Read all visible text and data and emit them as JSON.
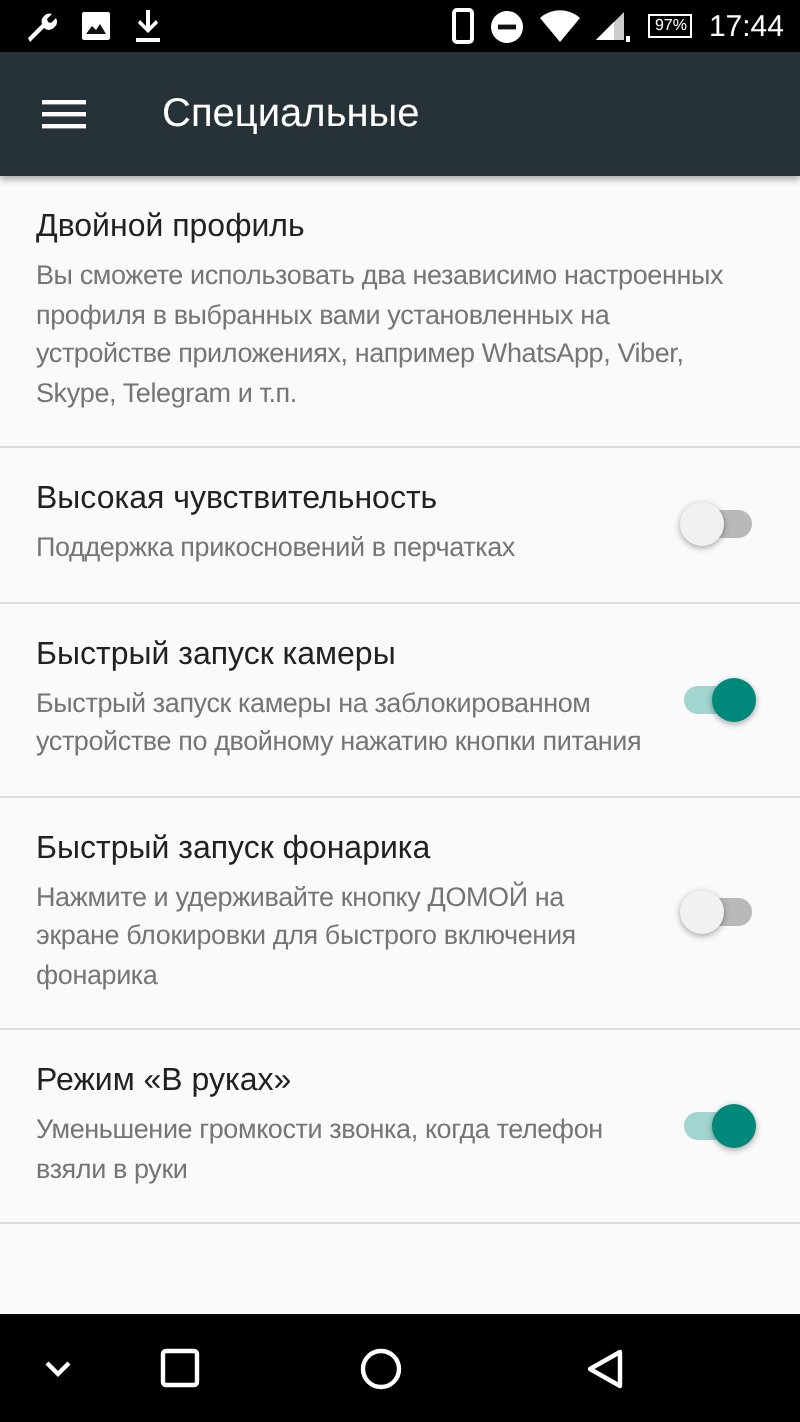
{
  "status_bar": {
    "battery": "97%",
    "time": "17:44"
  },
  "app_bar": {
    "title": "Специальные"
  },
  "settings": [
    {
      "kind": "plain",
      "title": "Двойной профиль",
      "summary": "Вы сможете использовать два независимо настроенных профиля в выбранных вами установленных на устройстве приложениях, например WhatsApp, Viber, Skype, Telegram и т.п."
    },
    {
      "kind": "switch",
      "title": "Высокая чувствительность",
      "summary": "Поддержка прикосновений в перчатках",
      "on": false
    },
    {
      "kind": "switch",
      "title": "Быстрый запуск камеры",
      "summary": "Быстрый запуск камеры на заблокированном устройстве по двойному нажатию кнопки питания",
      "on": true
    },
    {
      "kind": "switch",
      "title": "Быстрый запуск фонарика",
      "summary": "Нажмите и удерживайте кнопку ДОМОЙ на экране блокировки для быстрого включения фонарика",
      "on": false
    },
    {
      "kind": "switch",
      "title": "Режим «В руках»",
      "summary": "Уменьшение громкости звонка, когда телефон взяли в руки",
      "on": true
    }
  ]
}
